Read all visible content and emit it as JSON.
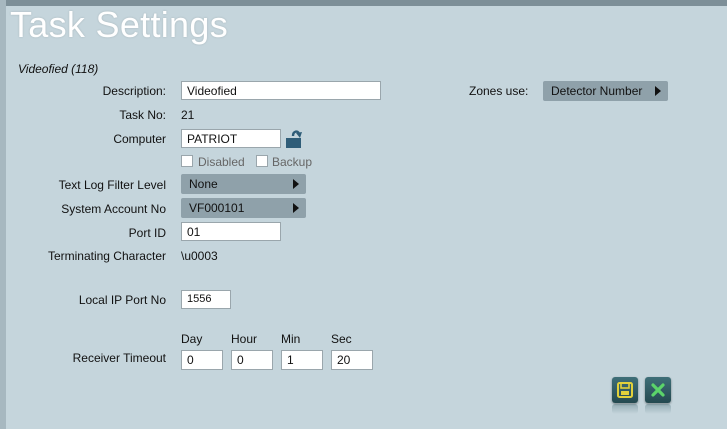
{
  "title": "Task Settings",
  "subtitle": "Videofied (118)",
  "fields": {
    "description_label": "Description:",
    "description_value": "Videofied",
    "task_no_label": "Task No:",
    "task_no_value": "21",
    "computer_label": "Computer",
    "computer_value": "PATRIOT",
    "disabled_label": "Disabled",
    "backup_label": "Backup",
    "text_log_label": "Text Log Filter Level",
    "text_log_value": "None",
    "system_account_label": "System Account No",
    "system_account_value": "VF000101",
    "port_id_label": "Port ID",
    "port_id_value": "01",
    "terminating_label": "Terminating Character",
    "terminating_value": "\\u0003",
    "local_ip_label": "Local IP Port No",
    "local_ip_value": "1556",
    "zones_label": "Zones use:",
    "zones_value": "Detector Number"
  },
  "timeout": {
    "label": "Receiver Timeout",
    "day_label": "Day",
    "hour_label": "Hour",
    "min_label": "Min",
    "sec_label": "Sec",
    "day": "0",
    "hour": "0",
    "min": "1",
    "sec": "20"
  },
  "checkboxes": {
    "disabled": false,
    "backup": false
  },
  "icons": {
    "computer_action": "folder-open-arrow-icon",
    "save": "save-icon",
    "cancel": "close-icon"
  },
  "colors": {
    "background": "#c5d5dc",
    "dropdown": "#8fa1aa",
    "button": "#2d555c",
    "save_icon": "#e2d13a",
    "cancel_icon": "#5bd46a"
  }
}
